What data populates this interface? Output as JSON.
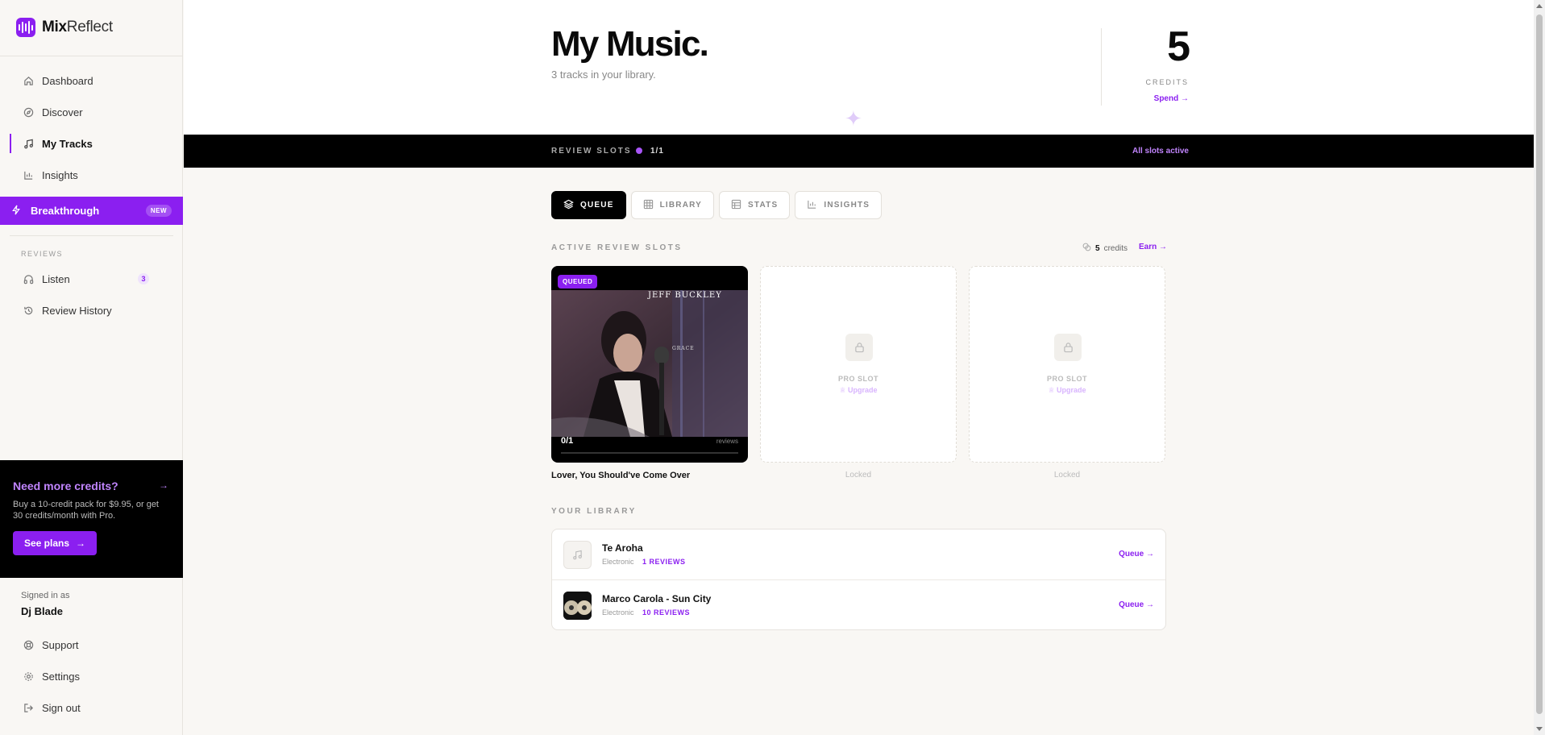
{
  "brand": {
    "name_bold": "Mix",
    "name_light": "Reflect"
  },
  "sidebar": {
    "nav": [
      {
        "label": "Dashboard",
        "icon": "home-icon"
      },
      {
        "label": "Discover",
        "icon": "compass-icon"
      },
      {
        "label": "My Tracks",
        "icon": "music-note-icon"
      },
      {
        "label": "Insights",
        "icon": "bar-chart-icon"
      }
    ],
    "breakthrough": {
      "label": "Breakthrough",
      "badge": "NEW"
    },
    "reviews_section": "REVIEWS",
    "reviews": [
      {
        "label": "Listen",
        "icon": "headphones-icon",
        "count": "3"
      },
      {
        "label": "Review History",
        "icon": "history-icon"
      }
    ],
    "promo": {
      "title": "Need more credits?",
      "text": "Buy a 10-credit pack for $9.95, or get 30 credits/month with Pro.",
      "button": "See plans"
    },
    "signed_in_label": "Signed in as",
    "user_name": "Dj Blade",
    "footer": [
      {
        "label": "Support",
        "icon": "lifebuoy-icon"
      },
      {
        "label": "Settings",
        "icon": "gear-icon"
      },
      {
        "label": "Sign out",
        "icon": "sign-out-icon"
      }
    ]
  },
  "header": {
    "title": "My Music.",
    "subtitle": "3 tracks in your library.",
    "credits": "5",
    "credits_label": "CREDITS",
    "spend": "Spend →"
  },
  "slots_bar": {
    "label": "REVIEW SLOTS",
    "count": "1/1",
    "status": "All slots active"
  },
  "tabs": [
    {
      "label": "QUEUE",
      "icon": "layers-icon",
      "active": true
    },
    {
      "label": "LIBRARY",
      "icon": "grid-icon",
      "active": false
    },
    {
      "label": "STATS",
      "icon": "table-icon",
      "active": false
    },
    {
      "label": "INSIGHTS",
      "icon": "bar-chart-icon",
      "active": false
    }
  ],
  "active_slots": {
    "label": "ACTIVE REVIEW SLOTS",
    "credits_bold": "5",
    "credits_suffix": "credits",
    "earn": "Earn →",
    "filled": {
      "badge": "QUEUED",
      "cover_artist": "JEFF BUCKLEY",
      "cover_album": "GRACE",
      "progress": "0/1",
      "progress_value": 0,
      "progress_label": "reviews",
      "title": "Lover, You Should've Come Over"
    },
    "locked": [
      {
        "label": "PRO SLOT",
        "upgrade": "Upgrade",
        "caption": "Locked"
      },
      {
        "label": "PRO SLOT",
        "upgrade": "Upgrade",
        "caption": "Locked"
      }
    ]
  },
  "library": {
    "label": "YOUR LIBRARY",
    "rows": [
      {
        "title": "Te Aroha",
        "genre": "Electronic",
        "reviews": "1 REVIEWS",
        "action": "Queue"
      },
      {
        "title": "Marco Carola - Sun City",
        "genre": "Electronic",
        "reviews": "10 REVIEWS",
        "action": "Queue"
      }
    ]
  },
  "colors": {
    "accent": "#8b1ff0",
    "accent_light": "#c084fc",
    "background": "#f9f7f4"
  }
}
